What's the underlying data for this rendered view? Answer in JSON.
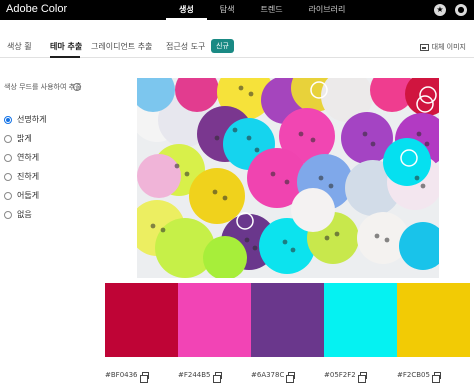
{
  "app": {
    "title": "Adobe Color"
  },
  "topnav": {
    "items": [
      "생성",
      "탐색",
      "트렌드",
      "라이브러리"
    ],
    "active": "생성"
  },
  "top_icons": [
    "star-icon",
    "avatar-icon"
  ],
  "tabs": {
    "items": [
      "색상 휠",
      "테마 추출",
      "그레이디언트 추출",
      "접근성 도구"
    ],
    "active": "테마 추출",
    "badge": "신규",
    "alt_image": "대체 이미지"
  },
  "mood": {
    "label": "색상 무드를 사용하여 추출",
    "info_icon": "info-icon",
    "options": [
      "선명하게",
      "밝게",
      "연하게",
      "진하게",
      "어둡게",
      "없음"
    ],
    "selected": "선명하게"
  },
  "photo": {
    "description_icon": "colorful-buttons-photo"
  },
  "palette": {
    "colors": [
      "#BF0436",
      "#F244B5",
      "#6A378C",
      "#05F2F2",
      "#F2CB05"
    ],
    "labels": [
      "#BF0436",
      "#F244B5",
      "#6A378C",
      "#05F2F2",
      "#F2CB05"
    ]
  }
}
